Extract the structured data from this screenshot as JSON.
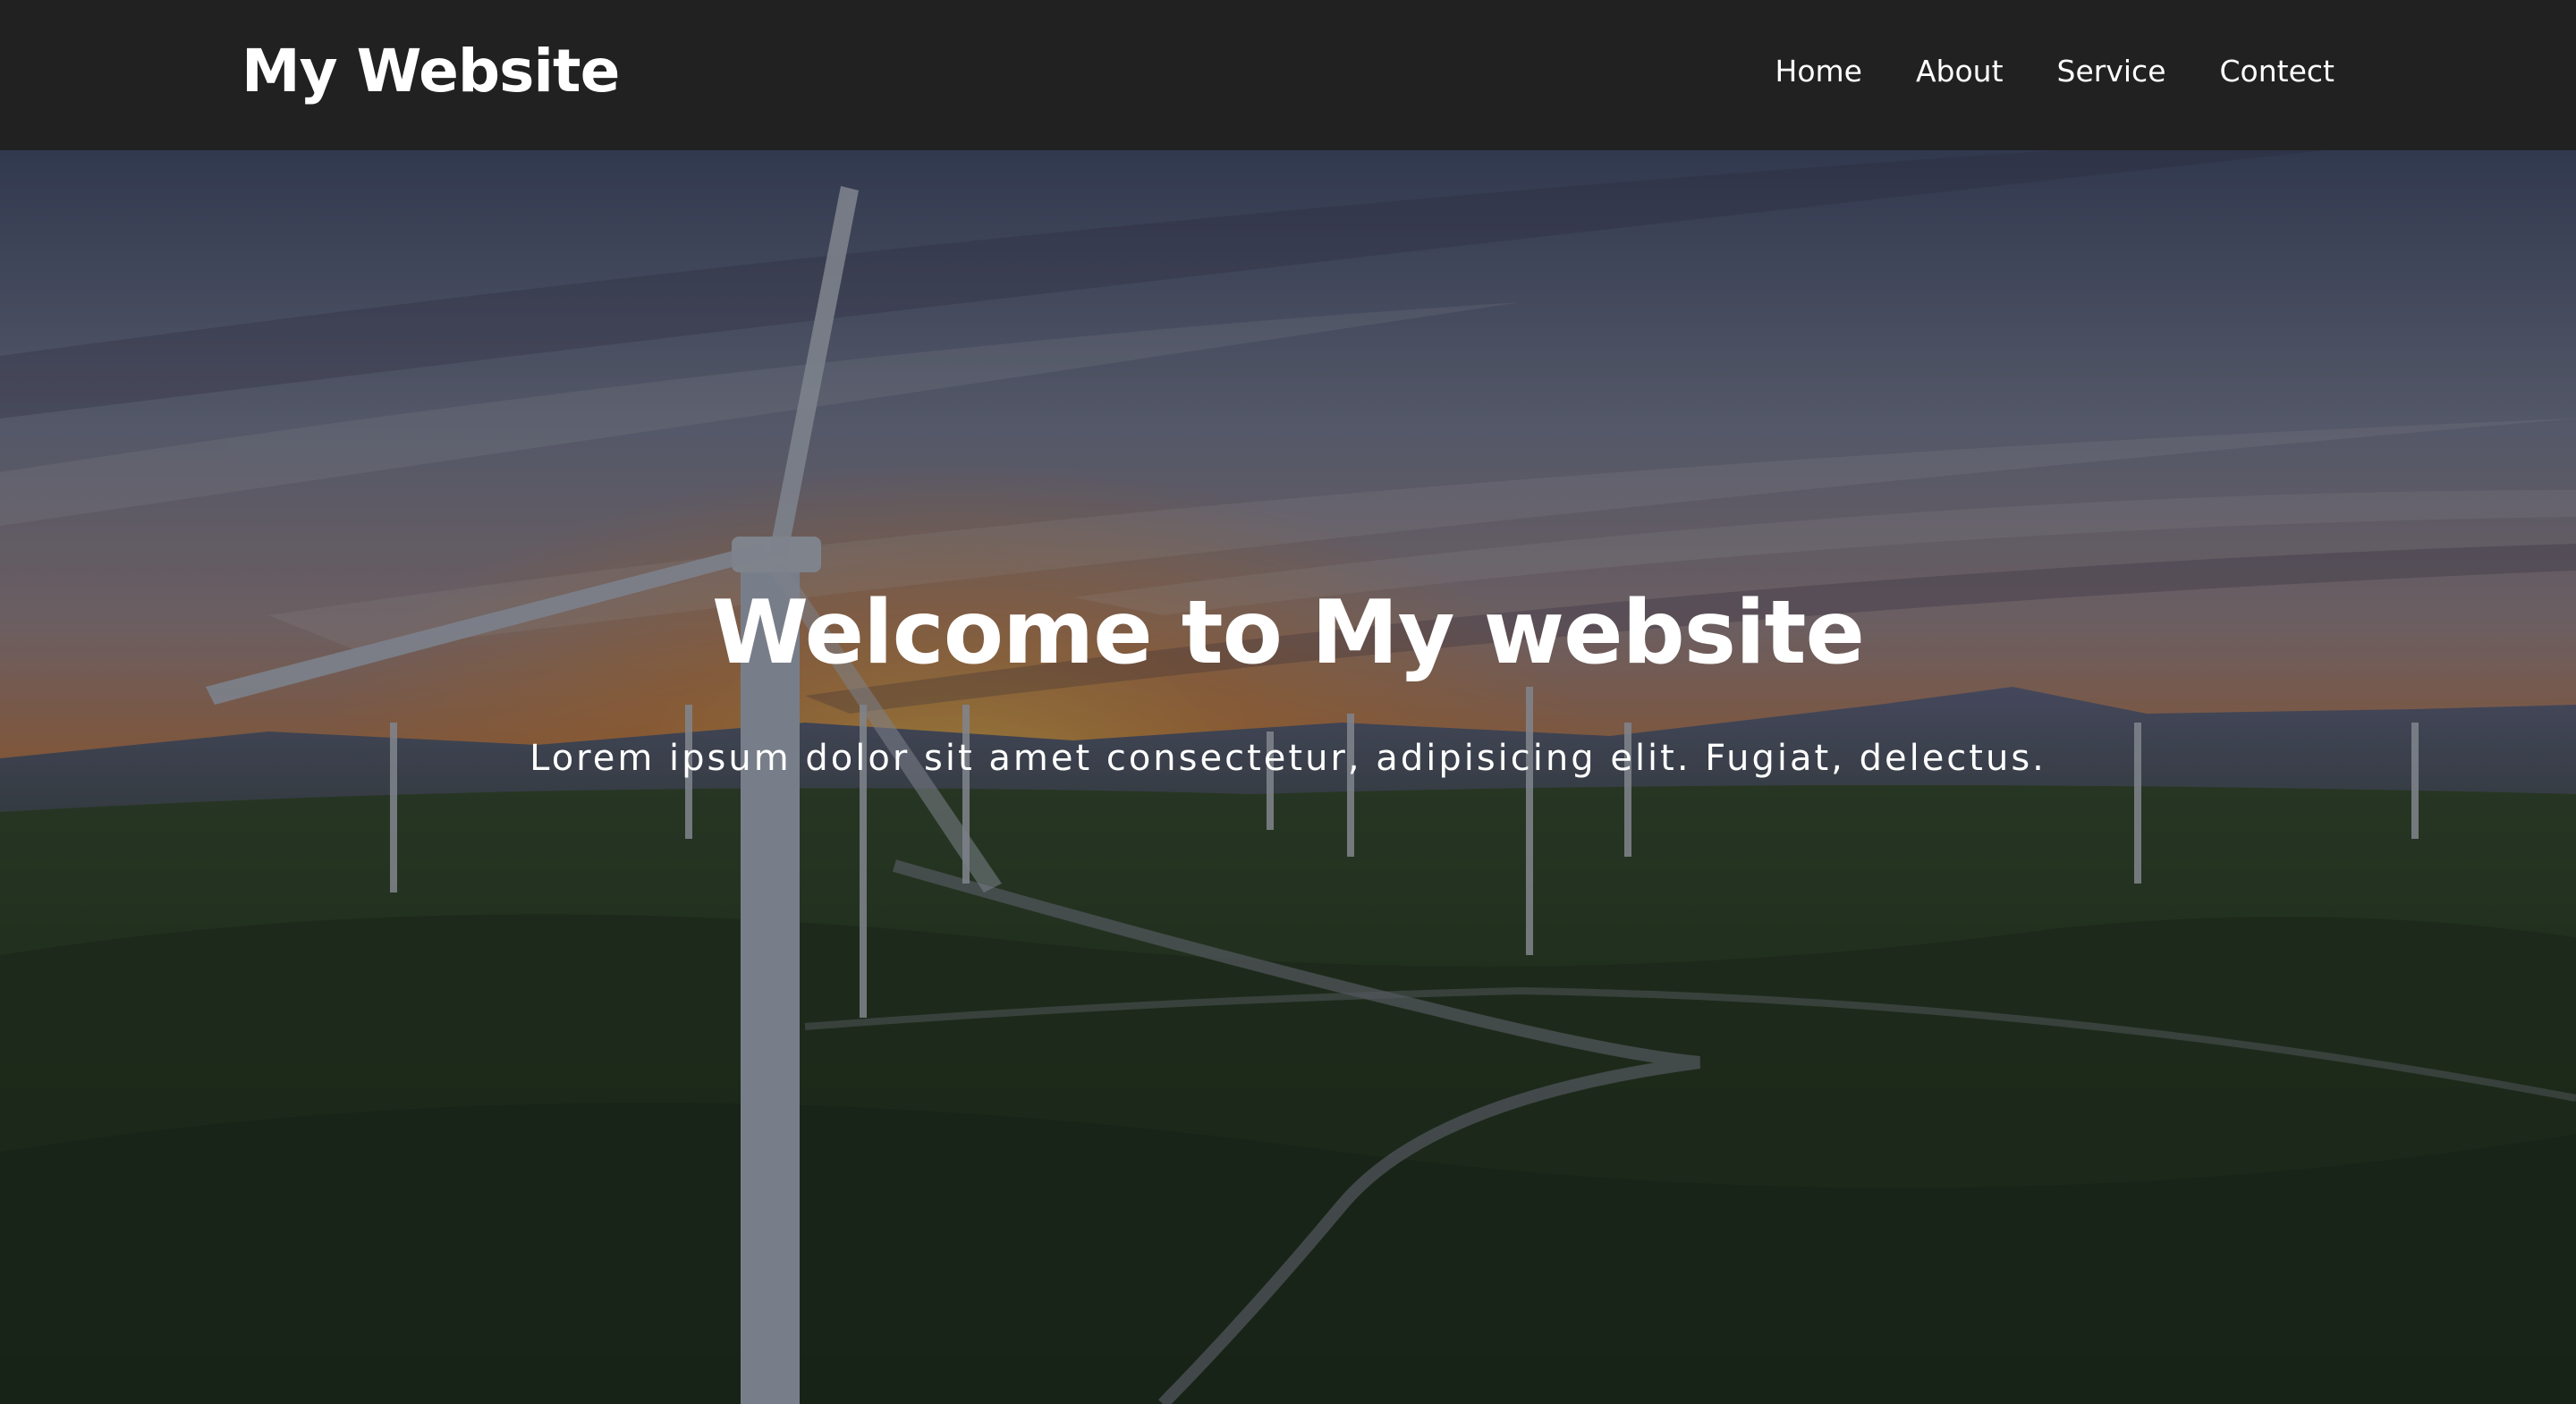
{
  "navbar": {
    "brand": "My Website",
    "links": [
      {
        "label": "Home"
      },
      {
        "label": "About"
      },
      {
        "label": "Service"
      },
      {
        "label": "Contect"
      }
    ]
  },
  "hero": {
    "title": "Welcome to My website",
    "subtitle": "Lorem ipsum dolor sit amet consectetur, adipisicing elit. Fugiat, delectus.",
    "background_image": "wind-turbines-sunset-hills"
  },
  "colors": {
    "navbar_bg": "#212121",
    "text": "#ffffff",
    "sky_warm": "#e08a3a",
    "hills": "#2f4a22"
  }
}
